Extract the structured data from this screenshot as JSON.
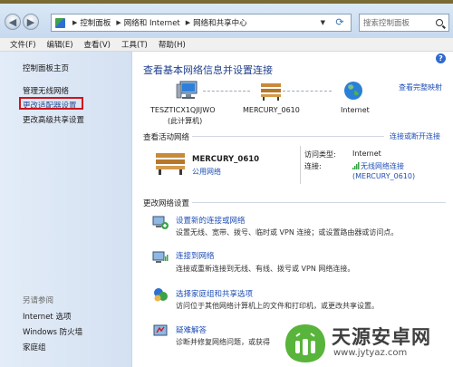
{
  "address_bar": {
    "breadcrumbs": [
      "控制面板",
      "网络和 Internet",
      "网络和共享中心"
    ],
    "search_placeholder": "搜索控制面板"
  },
  "menu": [
    "文件(F)",
    "编辑(E)",
    "查看(V)",
    "工具(T)",
    "帮助(H)"
  ],
  "sidebar": {
    "home": "控制面板主页",
    "links": [
      "管理无线网络",
      "更改适配器设置",
      "更改高级共享设置"
    ],
    "see_also_title": "另请参阅",
    "see_also": [
      "Internet 选项",
      "Windows 防火墙",
      "家庭组"
    ]
  },
  "main": {
    "title": "查看基本网络信息并设置连接",
    "full_map_link": "查看完整映射",
    "map": {
      "computer_name": "TESZTICX1QJIJWO",
      "computer_sub": "(此计算机)",
      "router_name": "MERCURY_0610",
      "internet": "Internet"
    },
    "active": {
      "title": "查看活动网络",
      "connect_link": "连接或断开连接",
      "network_name": "MERCURY_0610",
      "network_type": "公用网络",
      "access_type_key": "访问类型:",
      "access_type_value": "Internet",
      "connection_key": "连接:",
      "connection_value": "无线网络连接",
      "connection_ssid": "(MERCURY_0610)"
    },
    "change_title": "更改网络设置",
    "tasks": [
      {
        "link": "设置新的连接或网络",
        "desc": "设置无线、宽带、拨号、临时或 VPN 连接；或设置路由器或访问点。"
      },
      {
        "link": "连接到网络",
        "desc": "连接或重新连接到无线、有线、拨号或 VPN 网络连接。"
      },
      {
        "link": "选择家庭组和共享选项",
        "desc": "访问位于其他网络计算机上的文件和打印机，或更改共享设置。"
      },
      {
        "link": "疑难解答",
        "desc": "诊断并修复网络问题，或获得"
      }
    ]
  },
  "watermark": {
    "text": "天源安卓网",
    "url": "www.jytyaz.com"
  },
  "colors": {
    "link": "#1f4fb5",
    "title": "#1f3f8c",
    "highlight": "#d0131c",
    "sidebar": "#dce7f5"
  }
}
